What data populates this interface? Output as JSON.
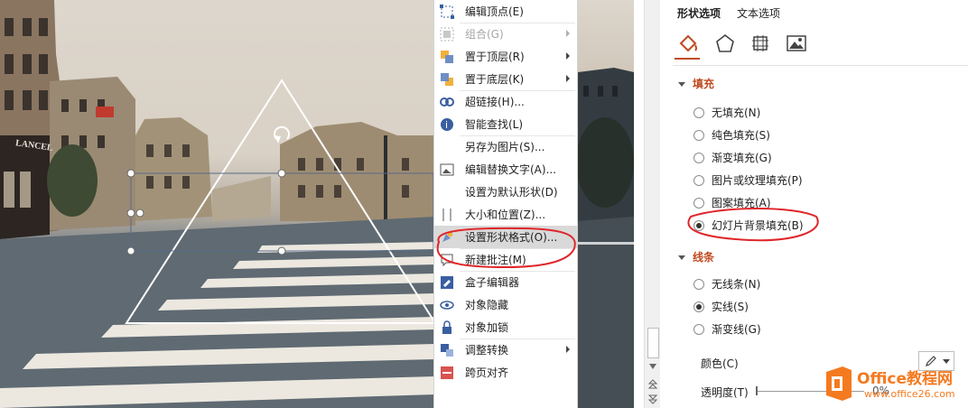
{
  "context_menu": {
    "items": [
      {
        "label": "编辑顶点(E)",
        "icon": "edit-points-icon",
        "disabled": false,
        "submenu": false
      },
      {
        "label": "组合(G)",
        "icon": "group-icon",
        "disabled": true,
        "submenu": true
      },
      {
        "label": "置于顶层(R)",
        "icon": "bring-to-front-icon",
        "disabled": false,
        "submenu": true
      },
      {
        "label": "置于底层(K)",
        "icon": "send-to-back-icon",
        "disabled": false,
        "submenu": true
      },
      {
        "label": "超链接(H)...",
        "icon": "hyperlink-icon",
        "disabled": false,
        "submenu": false
      },
      {
        "label": "智能查找(L)",
        "icon": "smart-lookup-icon",
        "disabled": false,
        "submenu": false
      },
      {
        "label": "另存为图片(S)...",
        "icon": "",
        "disabled": false,
        "submenu": false
      },
      {
        "label": "编辑替换文字(A)...",
        "icon": "alt-text-icon",
        "disabled": false,
        "submenu": false
      },
      {
        "label": "设置为默认形状(D)",
        "icon": "",
        "disabled": false,
        "submenu": false
      },
      {
        "label": "大小和位置(Z)...",
        "icon": "size-position-icon",
        "disabled": false,
        "submenu": false
      },
      {
        "label": "设置形状格式(O)...",
        "icon": "format-shape-icon",
        "disabled": false,
        "submenu": false
      },
      {
        "label": "新建批注(M)",
        "icon": "new-comment-icon",
        "disabled": false,
        "submenu": false
      },
      {
        "label": "盒子编辑器",
        "icon": "box-editor-icon",
        "disabled": false,
        "submenu": false
      },
      {
        "label": "对象隐藏",
        "icon": "hide-object-icon",
        "disabled": false,
        "submenu": false
      },
      {
        "label": "对象加锁",
        "icon": "lock-icon",
        "disabled": false,
        "submenu": false
      },
      {
        "label": "调整转换",
        "icon": "convert-icon",
        "disabled": false,
        "submenu": true
      },
      {
        "label": "跨页对齐",
        "icon": "cross-page-align-icon",
        "disabled": false,
        "submenu": false
      }
    ],
    "highlighted_index": 10
  },
  "pane": {
    "tabs": [
      "形状选项",
      "文本选项"
    ],
    "icons": [
      "fill-line-icon",
      "effects-pentagon-icon",
      "size-properties-icon",
      "picture-icon"
    ],
    "fill": {
      "title": "填充",
      "options": [
        "无填充(N)",
        "纯色填充(S)",
        "渐变填充(G)",
        "图片或纹理填充(P)",
        "图案填充(A)",
        "幻灯片背景填充(B)"
      ],
      "selected": 5
    },
    "line": {
      "title": "线条",
      "options": [
        "无线条(N)",
        "实线(S)",
        "渐变线(G)"
      ],
      "selected": 1,
      "color_label": "颜色(C)",
      "transparency_label": "透明度(T)",
      "transparency_value": "0%"
    }
  },
  "photo": {
    "sign_text": "LANCEL"
  },
  "watermark": {
    "brand": "Office教程网",
    "url": "www.office26.com"
  },
  "colors": {
    "accent": "#c04a1f",
    "annotation": "#e0262a",
    "watermark_orange": "#f47a20"
  }
}
